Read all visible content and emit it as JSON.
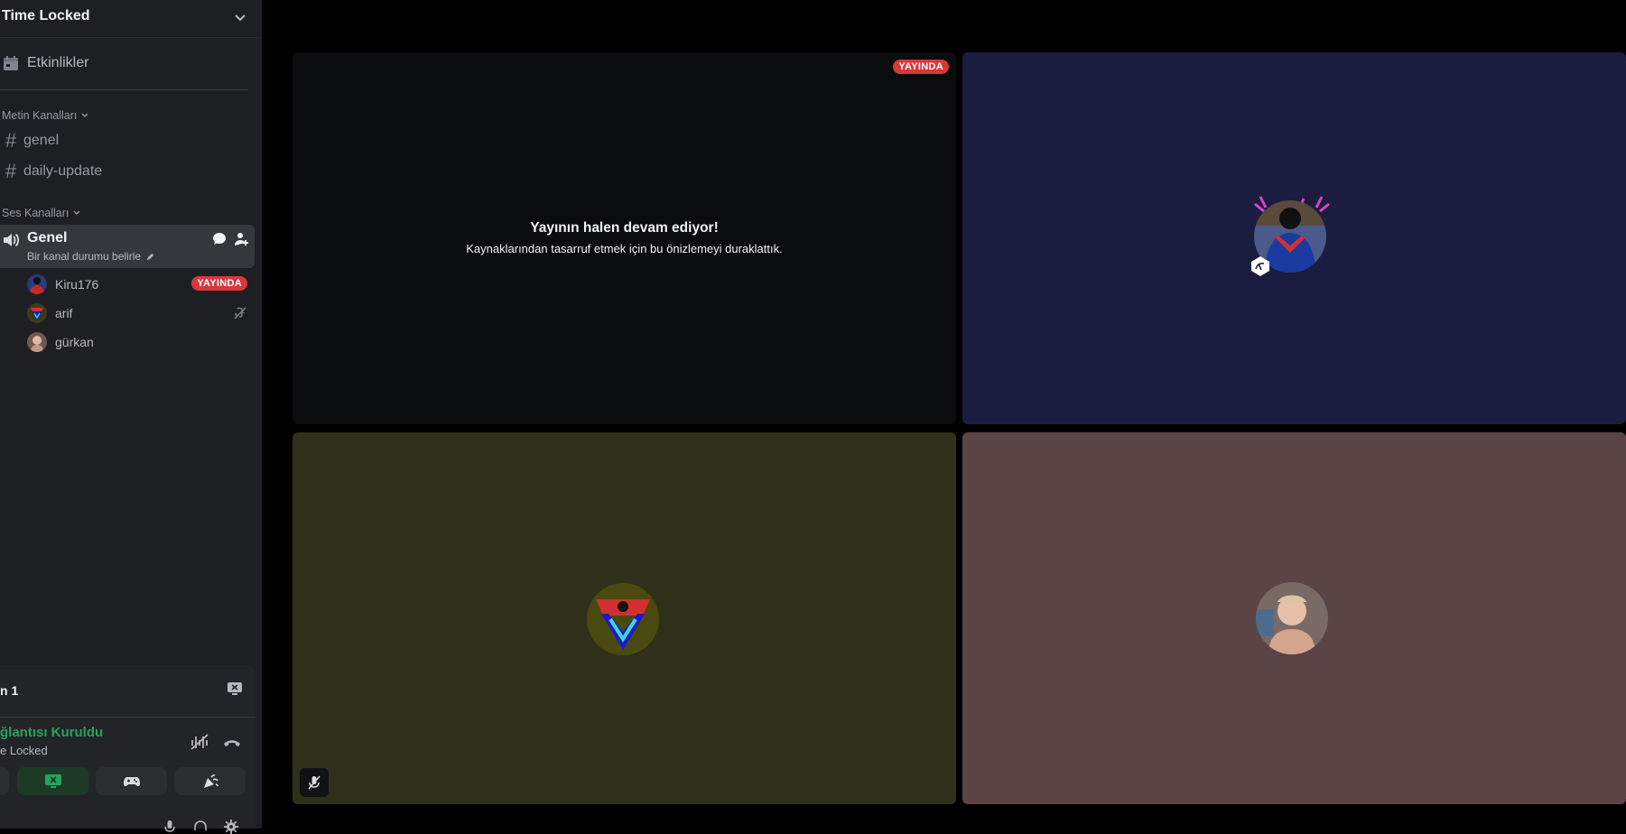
{
  "server": {
    "name": "Time Locked"
  },
  "sidebar": {
    "events_label": "Etkinlikler",
    "text_category": "Metin Kanalları",
    "text_channels": [
      {
        "label": "genel"
      },
      {
        "label": "daily-update"
      }
    ],
    "voice_category": "Ses Kanalları",
    "voice_channel": {
      "name": "Genel",
      "status_placeholder": "Bir kanal durumu belirle"
    },
    "members": [
      {
        "name": "Kiru176",
        "badge": "YAYINDA"
      },
      {
        "name": "arif"
      },
      {
        "name": "gürkan"
      }
    ]
  },
  "voice_panel": {
    "title": "n 1",
    "connection_status": "ğlantısı Kuruldu",
    "server_name": "e Locked"
  },
  "stage": {
    "tile1": {
      "badge": "YAYINDA",
      "title": "Yayının halen devam ediyor!",
      "subtitle": "Kaynaklarından tasarruf etmek için bu önizlemeyi duraklattık."
    }
  },
  "colors": {
    "live_red": "#da373c",
    "connected_green": "#23a559",
    "tile2_bg": "#1a1d3f",
    "tile3_bg": "#2f301a",
    "tile4_bg": "#5a4445"
  }
}
